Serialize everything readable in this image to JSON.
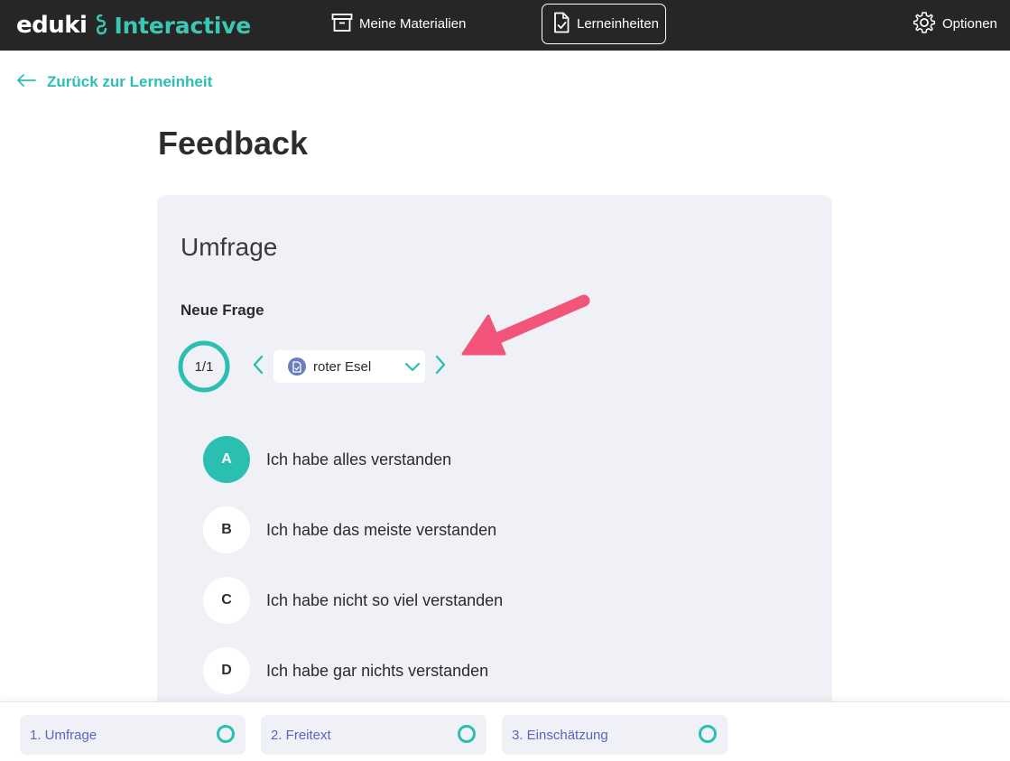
{
  "header": {
    "logo_left": "eduki",
    "logo_right": "Interactive",
    "nav": {
      "materials": "Meine Materialien",
      "units": "Lerneinheiten",
      "options": "Optionen"
    }
  },
  "back_link": "Zurück zur Lerneinheit",
  "page_title": "Feedback",
  "card": {
    "title": "Umfrage",
    "question_label": "Neue Frage",
    "progress": "1/1",
    "selected_question": "roter Esel",
    "options": [
      {
        "letter": "A",
        "text": "Ich habe alles verstanden",
        "selected": true
      },
      {
        "letter": "B",
        "text": "Ich habe das meiste verstanden",
        "selected": false
      },
      {
        "letter": "C",
        "text": "Ich habe nicht so viel verstanden",
        "selected": false
      },
      {
        "letter": "D",
        "text": "Ich habe gar nichts verstanden",
        "selected": false
      }
    ]
  },
  "steps": [
    {
      "label": "1. Umfrage"
    },
    {
      "label": "2. Freitext"
    },
    {
      "label": "3. Einschätzung"
    }
  ],
  "colors": {
    "accent": "#2bbfb1",
    "header_bg": "#262626",
    "card_bg": "#eff1f7",
    "step_text": "#5b63c4",
    "annotation_arrow": "#f2547a"
  }
}
